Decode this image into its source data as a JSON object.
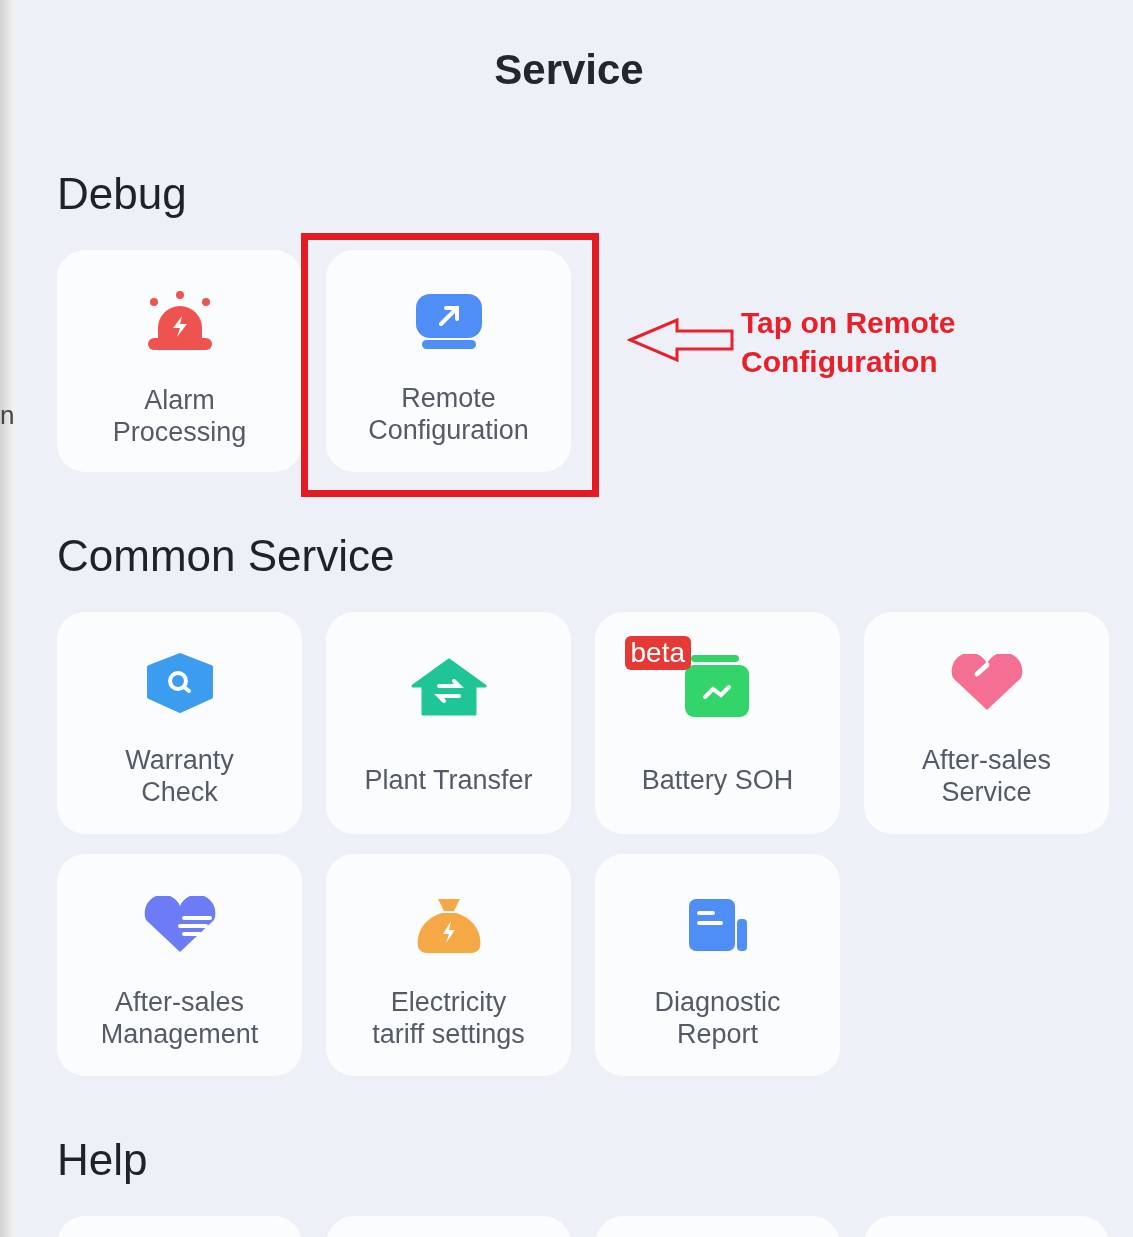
{
  "left_edge": {
    "text": "n"
  },
  "title": "Service",
  "sections": [
    {
      "title": "Debug",
      "tiles": [
        {
          "kind": "alarm",
          "lines": [
            "Alarm",
            "Processing"
          ],
          "highlighted": false
        },
        {
          "kind": "remote",
          "lines": [
            "Remote",
            "Configuration"
          ],
          "highlighted": true
        }
      ]
    },
    {
      "title": "Common Service",
      "tiles": [
        {
          "kind": "warranty",
          "lines": [
            "Warranty",
            "Check"
          ],
          "highlighted": false
        },
        {
          "kind": "transfer",
          "lines": [
            "Plant Transfer"
          ],
          "highlighted": false
        },
        {
          "kind": "battery",
          "lines": [
            "Battery SOH"
          ],
          "badge": "beta",
          "highlighted": false
        },
        {
          "kind": "service",
          "lines": [
            "After-sales",
            "Service"
          ],
          "highlighted": false
        },
        {
          "kind": "management",
          "lines": [
            "After-sales",
            "Management"
          ],
          "highlighted": false
        },
        {
          "kind": "tariff",
          "lines": [
            "Electricity",
            "tariff settings"
          ],
          "highlighted": false
        },
        {
          "kind": "report",
          "lines": [
            "Diagnostic",
            "Report"
          ],
          "highlighted": false
        }
      ]
    },
    {
      "title": "Help",
      "tiles": [
        {
          "kind": "blank"
        },
        {
          "kind": "blank"
        },
        {
          "kind": "blank"
        },
        {
          "kind": "blank"
        }
      ]
    }
  ],
  "annotation": {
    "lines": [
      "Tap on Remote",
      "Configuration"
    ]
  }
}
